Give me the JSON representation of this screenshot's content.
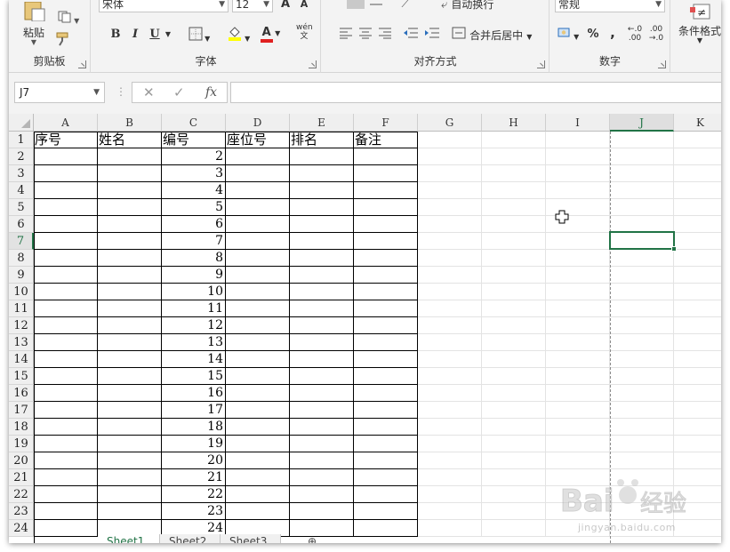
{
  "ribbon": {
    "clipboard": {
      "paste_label": "粘贴",
      "group_label": "剪贴板"
    },
    "font": {
      "font_name": "宋体",
      "font_size": "12",
      "bold": "B",
      "italic": "I",
      "underline": "U",
      "font_color_glyph": "A",
      "group_label": "字体",
      "phonetic_glyph": "wén 文"
    },
    "alignment": {
      "wrap_text": "自动换行",
      "merge_center": "合并后居中",
      "group_label": "对齐方式"
    },
    "number": {
      "format": "常规",
      "percent": "%",
      "comma": ",",
      "inc_decimal": "←.0 .00",
      "dec_decimal": ".00 →.0",
      "group_label": "数字"
    },
    "styles": {
      "conditional_format": "条件格式"
    }
  },
  "formula_bar": {
    "name_box": "J7",
    "cancel_icon": "✕",
    "enter_icon": "✓",
    "fx_label": "fx",
    "value": ""
  },
  "grid": {
    "columns": [
      "A",
      "B",
      "C",
      "D",
      "E",
      "F",
      "G",
      "H",
      "I",
      "J",
      "K"
    ],
    "selected_column": "J",
    "selected_row": "7",
    "rows": [
      {
        "num": "1",
        "A": "序号",
        "B": "姓名",
        "C": "编号",
        "D": "座位号",
        "E": "排名",
        "F": "备注"
      },
      {
        "num": "2",
        "C": "2"
      },
      {
        "num": "3",
        "C": "3"
      },
      {
        "num": "4",
        "C": "4"
      },
      {
        "num": "5",
        "C": "5"
      },
      {
        "num": "6",
        "C": "6"
      },
      {
        "num": "7",
        "C": "7"
      },
      {
        "num": "8",
        "C": "8"
      },
      {
        "num": "9",
        "C": "9"
      },
      {
        "num": "10",
        "C": "10"
      },
      {
        "num": "11",
        "C": "11"
      },
      {
        "num": "12",
        "C": "12"
      },
      {
        "num": "13",
        "C": "13"
      },
      {
        "num": "14",
        "C": "14"
      },
      {
        "num": "15",
        "C": "15"
      },
      {
        "num": "16",
        "C": "16"
      },
      {
        "num": "17",
        "C": "17"
      },
      {
        "num": "18",
        "C": "18"
      },
      {
        "num": "19",
        "C": "19"
      },
      {
        "num": "20",
        "C": "20"
      },
      {
        "num": "21",
        "C": "21"
      },
      {
        "num": "22",
        "C": "22"
      },
      {
        "num": "23",
        "C": "23"
      },
      {
        "num": "24",
        "C": "24"
      }
    ]
  },
  "sheet_tabs": [
    "Sheet1",
    "Sheet2",
    "Sheet3"
  ],
  "active_sheet": "Sheet1",
  "watermark": {
    "text": "jingyan.baidu.com"
  },
  "colors": {
    "accent": "#217346"
  }
}
